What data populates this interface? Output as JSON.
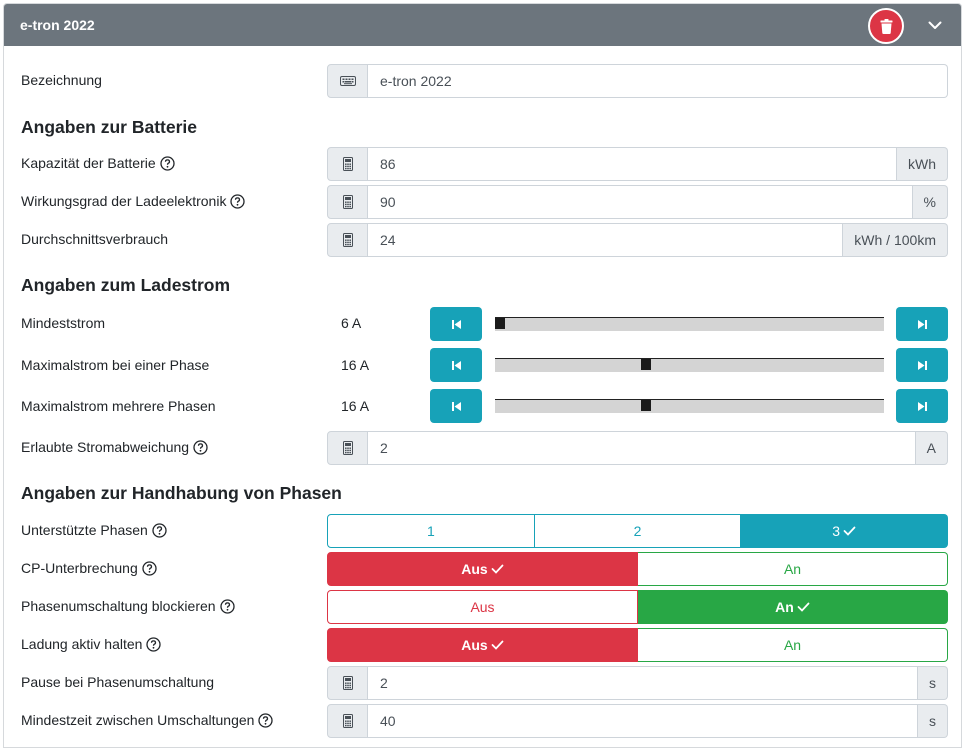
{
  "header": {
    "title": "e-tron 2022"
  },
  "fields": {
    "name": {
      "label": "Bezeichnung",
      "value": "e-tron 2022"
    },
    "capacity": {
      "label": "Kapazität der Batterie",
      "value": "86",
      "unit": "kWh"
    },
    "efficiency": {
      "label": "Wirkungsgrad der Ladeelektronik",
      "value": "90",
      "unit": "%"
    },
    "consumption": {
      "label": "Durchschnittsverbrauch",
      "value": "24",
      "unit": "kWh / 100km"
    },
    "deviation": {
      "label": "Erlaubte Stromabweichung",
      "value": "2",
      "unit": "A"
    },
    "pause": {
      "label": "Pause bei Phasenumschaltung",
      "value": "2",
      "unit": "s"
    },
    "min_time": {
      "label": "Mindestzeit zwischen Umschaltungen",
      "value": "40",
      "unit": "s"
    }
  },
  "sections": {
    "battery": "Angaben zur Batterie",
    "charge_current": "Angaben zum Ladestrom",
    "phases": "Angaben zur Handhabung von Phasen"
  },
  "sliders": {
    "min_current": {
      "label": "Mindeststrom",
      "display": "6 A",
      "fraction": 0.0
    },
    "max_current_one": {
      "label": "Maximalstrom bei einer Phase",
      "display": "16 A",
      "fraction": 0.385
    },
    "max_current_multi": {
      "label": "Maximalstrom mehrere Phasen",
      "display": "16 A",
      "fraction": 0.385
    }
  },
  "toggles": {
    "phases": {
      "label": "Unterstützte Phasen",
      "options": [
        "1",
        "2",
        "3"
      ],
      "selected": "3"
    },
    "cp_interruption": {
      "label": "CP-Unterbrechung",
      "off": "Aus",
      "on": "An",
      "selected": "Aus"
    },
    "block_switch": {
      "label": "Phasenumschaltung blockieren",
      "off": "Aus",
      "on": "An",
      "selected": "An"
    },
    "keep_active": {
      "label": "Ladung aktiv halten",
      "off": "Aus",
      "on": "An",
      "selected": "Aus"
    }
  },
  "colors": {
    "header": "#6c757d",
    "info": "#17a2b8",
    "danger": "#dc3545",
    "success": "#28a745",
    "addon": "#e9ecef"
  }
}
